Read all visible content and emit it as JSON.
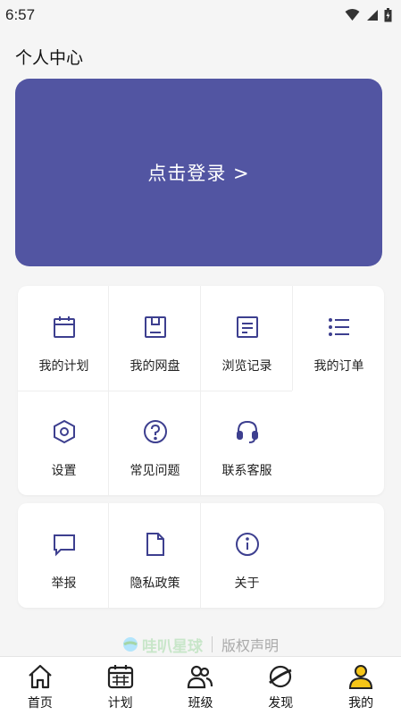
{
  "status_bar": {
    "time": "6:57",
    "icons": [
      "wifi-icon",
      "signal-icon",
      "battery-icon"
    ]
  },
  "page": {
    "title": "个人中心"
  },
  "login": {
    "label": "点击登录 >"
  },
  "menu_group_1": [
    {
      "label": "我的计划",
      "icon": "calendar-icon"
    },
    {
      "label": "我的网盘",
      "icon": "cloud-disk-icon"
    },
    {
      "label": "浏览记录",
      "icon": "history-doc-icon"
    },
    {
      "label": "我的订单",
      "icon": "order-list-icon"
    },
    {
      "label": "设置",
      "icon": "settings-hexagon-icon"
    },
    {
      "label": "常见问题",
      "icon": "question-icon"
    },
    {
      "label": "联系客服",
      "icon": "headset-icon"
    }
  ],
  "menu_group_2": [
    {
      "label": "举报",
      "icon": "report-chat-icon"
    },
    {
      "label": "隐私政策",
      "icon": "privacy-doc-icon"
    },
    {
      "label": "关于",
      "icon": "info-icon"
    }
  ],
  "footer": {
    "brand": "哇叭星球",
    "copyright": "版权声明"
  },
  "tabs": [
    {
      "label": "首页",
      "icon": "home-icon"
    },
    {
      "label": "计划",
      "icon": "calendar-grid-icon"
    },
    {
      "label": "班级",
      "icon": "group-icon"
    },
    {
      "label": "发现",
      "icon": "planet-icon"
    },
    {
      "label": "我的",
      "icon": "user-icon"
    }
  ],
  "colors": {
    "accent": "#5255a2",
    "icon": "#3d3f8f",
    "user_tab_yellow": "#f5c518"
  }
}
